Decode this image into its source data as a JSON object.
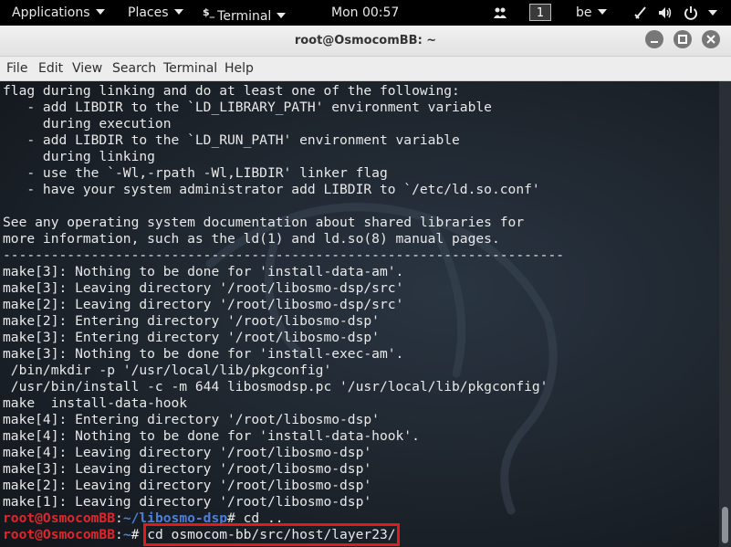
{
  "panel": {
    "applications": "Applications",
    "places": "Places",
    "terminal_app_icon": "$_",
    "terminal": "Terminal",
    "clock": "Mon 00:57",
    "workspace": "1",
    "keyboard_layout": "be",
    "icons": [
      "people-icon",
      "workspace-indicator",
      "keyboard-layout",
      "accessibility-icon",
      "volume-icon",
      "power-icon"
    ]
  },
  "window": {
    "title": "root@OsmocomBB: ~",
    "buttons": [
      "minimize",
      "maximize",
      "close"
    ]
  },
  "menu": [
    "File",
    "Edit",
    "View",
    "Search",
    "Terminal",
    "Help"
  ],
  "terminal": {
    "lines": [
      "flag during linking and do at least one of the following:",
      "   - add LIBDIR to the `LD_LIBRARY_PATH' environment variable",
      "     during execution",
      "   - add LIBDIR to the `LD_RUN_PATH' environment variable",
      "     during linking",
      "   - use the `-Wl,-rpath -Wl,LIBDIR' linker flag",
      "   - have your system administrator add LIBDIR to `/etc/ld.so.conf'",
      "",
      "See any operating system documentation about shared libraries for",
      "more information, such as the ld(1) and ld.so(8) manual pages.",
      "----------------------------------------------------------------------",
      "make[3]: Nothing to be done for 'install-data-am'.",
      "make[3]: Leaving directory '/root/libosmo-dsp/src'",
      "make[2]: Leaving directory '/root/libosmo-dsp/src'",
      "make[2]: Entering directory '/root/libosmo-dsp'",
      "make[3]: Entering directory '/root/libosmo-dsp'",
      "make[3]: Nothing to be done for 'install-exec-am'.",
      " /bin/mkdir -p '/usr/local/lib/pkgconfig'",
      " /usr/bin/install -c -m 644 libosmodsp.pc '/usr/local/lib/pkgconfig'",
      "make  install-data-hook",
      "make[4]: Entering directory '/root/libosmo-dsp'",
      "make[4]: Nothing to be done for 'install-data-hook'.",
      "make[4]: Leaving directory '/root/libosmo-dsp'",
      "make[3]: Leaving directory '/root/libosmo-dsp'",
      "make[2]: Leaving directory '/root/libosmo-dsp'",
      "make[1]: Leaving directory '/root/libosmo-dsp'"
    ],
    "prompt1": {
      "user_host": "root@OsmocomBB",
      "colon": ":",
      "path": "~/libosmo-dsp",
      "symbol": "# ",
      "command": "cd .."
    },
    "prompt2": {
      "user_host": "root@OsmocomBB",
      "colon": ":",
      "path": "~",
      "symbol": "# ",
      "command": "cd osmocom-bb/src/host/layer23/"
    },
    "colors": {
      "prompt_user": "#e0262b",
      "prompt_path": "#4c7fd9",
      "highlight_box": "#e11a1a"
    }
  }
}
